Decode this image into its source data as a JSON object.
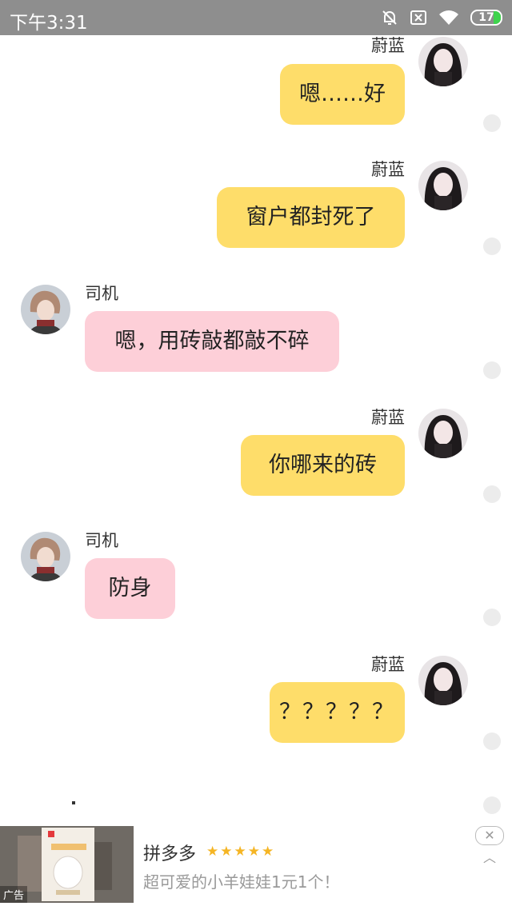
{
  "status_bar": {
    "time": "下午3:31",
    "battery": "17"
  },
  "messages": [
    {
      "sender": "蔚蓝",
      "side": "right",
      "text": "嗯……好"
    },
    {
      "sender": "蔚蓝",
      "side": "right",
      "text": "窗户都封死了"
    },
    {
      "sender": "司机",
      "side": "left",
      "text": "嗯，用砖敲都敲不碎"
    },
    {
      "sender": "蔚蓝",
      "side": "right",
      "text": "你哪来的砖"
    },
    {
      "sender": "司机",
      "side": "left",
      "text": "防身"
    },
    {
      "sender": "蔚蓝",
      "side": "right",
      "text": "？？？？？"
    }
  ],
  "ad": {
    "tag": "广告",
    "title": "拼多多",
    "stars": "★★★★★",
    "description": "超可爱的小羊娃娃1元1个！",
    "close": "✕",
    "chevron": "︿"
  },
  "colors": {
    "status_bar": "#8e8e8e",
    "right_bubble": "#fedd6a",
    "left_bubble": "#fdcfd8",
    "stars": "#f5b524"
  }
}
